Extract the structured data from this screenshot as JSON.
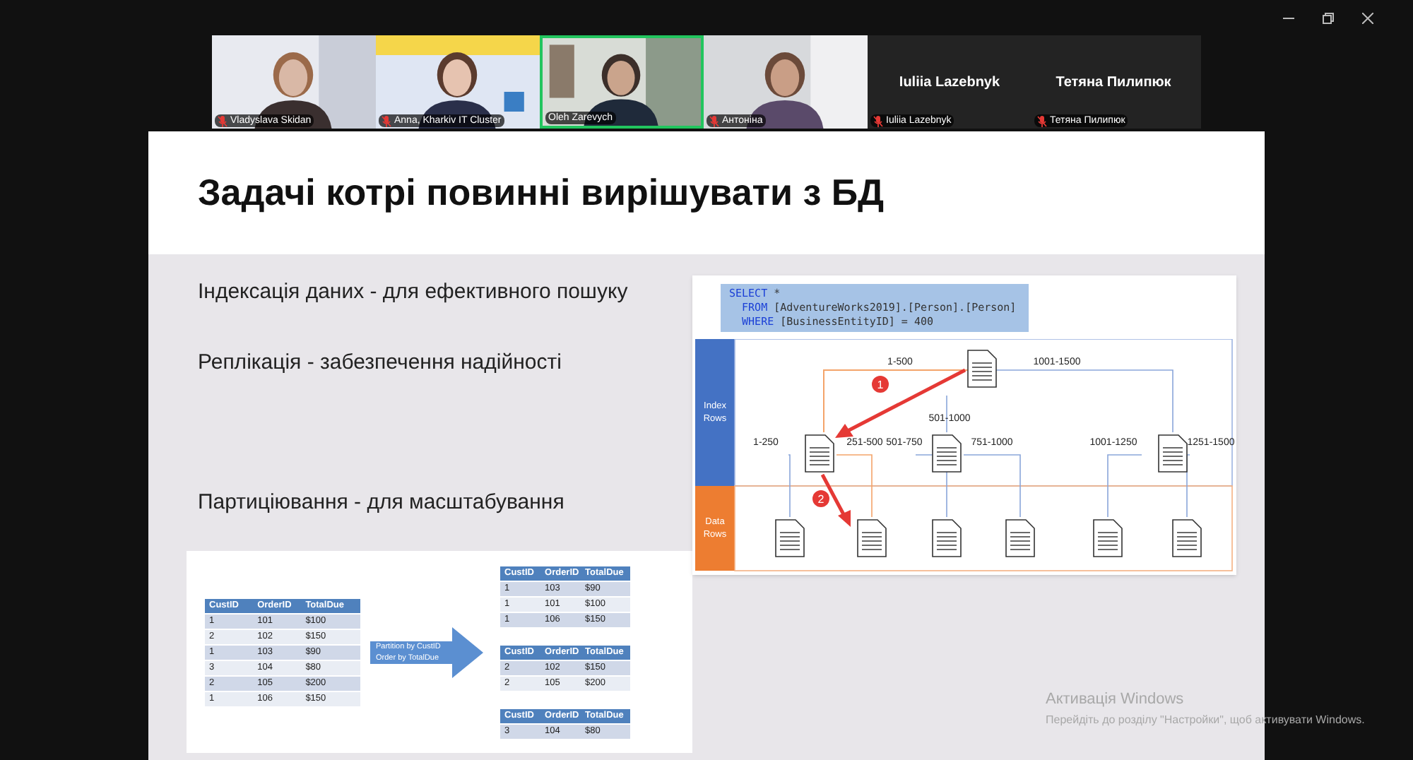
{
  "participants": [
    {
      "name": "Vladyslava Skidan",
      "video": true,
      "speaking": false,
      "muted": true
    },
    {
      "name": "Anna, Kharkiv IT Cluster",
      "video": true,
      "speaking": false,
      "muted": true
    },
    {
      "name": "Oleh Zarevych",
      "video": true,
      "speaking": true,
      "muted": false
    },
    {
      "name": "Антоніна",
      "video": true,
      "speaking": false,
      "muted": true
    },
    {
      "name": "Iuliia Lazebnyk",
      "display_name": "Iuliia Lazebnyk",
      "video": false,
      "speaking": false,
      "muted": true
    },
    {
      "name": "Тетяна Пилипюк",
      "display_name": "Тетяна Пилипюк",
      "video": false,
      "speaking": false,
      "muted": true
    }
  ],
  "slide": {
    "title": "Задачі котрі повинні вирішувати з БД",
    "bullets": [
      "Індексація даних - для ефективного пошуку",
      "Реплікація - забезпечення надійності",
      "Партиціювання - для масштабування"
    ],
    "diagram": {
      "sql_lines": [
        [
          {
            "kind": "keyword",
            "text": "SELECT"
          },
          {
            "kind": "plain",
            "text": " *"
          }
        ],
        [
          {
            "kind": "keyword",
            "text": "  FROM"
          },
          {
            "kind": "plain",
            "text": " [AdventureWorks2019].[Person].[Person]"
          }
        ],
        [
          {
            "kind": "keyword",
            "text": "  WHERE"
          },
          {
            "kind": "plain",
            "text": " [BusinessEntityID] = 400"
          }
        ]
      ],
      "bands": [
        "Index Rows",
        "Data Rows"
      ],
      "root_ranges": [
        "1-500",
        "501-1000",
        "1001-1500"
      ],
      "leaf_ranges": [
        "1-250",
        "251-500",
        "501-750",
        "751-1000",
        "1001-1250",
        "1251-1500"
      ],
      "steps": [
        "1",
        "2"
      ]
    },
    "partition": {
      "source": {
        "columns": [
          "CustID",
          "OrderID",
          "TotalDue"
        ],
        "rows": [
          [
            "1",
            "101",
            "$100"
          ],
          [
            "2",
            "102",
            "$150"
          ],
          [
            "1",
            "103",
            "$90"
          ],
          [
            "3",
            "104",
            "$80"
          ],
          [
            "2",
            "105",
            "$200"
          ],
          [
            "1",
            "106",
            "$150"
          ]
        ]
      },
      "arrow_label": [
        "Partition by CustID",
        "Order by TotalDue"
      ],
      "partitions": [
        {
          "columns": [
            "CustID",
            "OrderID",
            "TotalDue"
          ],
          "rows": [
            [
              "1",
              "103",
              "$90"
            ],
            [
              "1",
              "101",
              "$100"
            ],
            [
              "1",
              "106",
              "$150"
            ]
          ]
        },
        {
          "columns": [
            "CustID",
            "OrderID",
            "TotalDue"
          ],
          "rows": [
            [
              "2",
              "102",
              "$150"
            ],
            [
              "2",
              "105",
              "$200"
            ]
          ]
        },
        {
          "columns": [
            "CustID",
            "OrderID",
            "TotalDue"
          ],
          "rows": [
            [
              "3",
              "104",
              "$80"
            ]
          ]
        }
      ]
    }
  },
  "activation": {
    "title": "Активація Windows",
    "message": "Перейдіть до розділу \"Настройки\", щоб активувати Windows."
  }
}
